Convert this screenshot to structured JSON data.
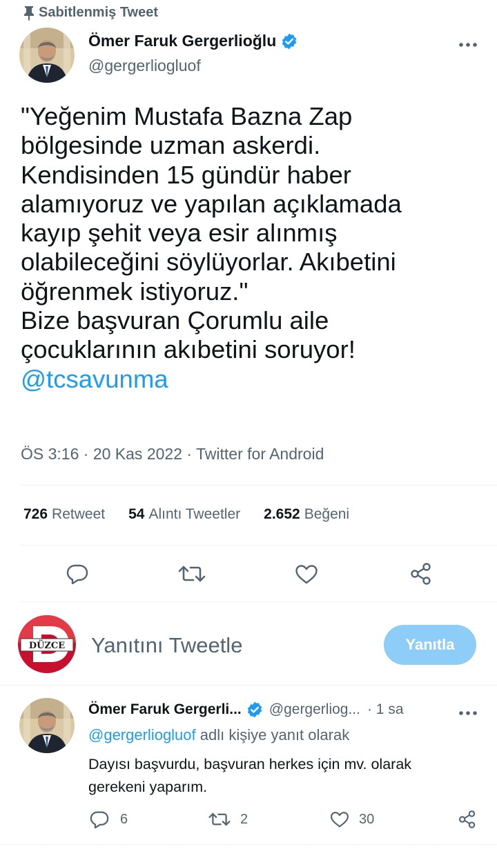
{
  "pinned": {
    "label": "Sabitlenmiş Tweet"
  },
  "tweet": {
    "author_name": "Ömer Faruk Gergerlioğlu",
    "author_handle": "@gergerliogluof",
    "text_main": "\"Yeğenim Mustafa Bazna Zap\nbölgesinde uzman askerdi.\nKendisinden 15 gündür haber\nalamıyoruz ve yapılan açıklamada\nkayıp şehit veya esir alınmış\nolabileceğini söylüyorlar. Akıbetini\nöğrenmek istiyoruz.\"\nBize başvuran Çorumlu aile\nçocuklarının akıbetini soruyor!",
    "mention": "@tcsavunma",
    "meta": "ÖS 3:16 · 20 Kas 2022 · Twitter for Android",
    "stats": {
      "retweets_count": "726",
      "retweets_label": "Retweet",
      "quotes_count": "54",
      "quotes_label": "Alıntı Tweetler",
      "likes_count": "2.652",
      "likes_label": "Beğeni"
    },
    "actions": [
      "reply-icon",
      "retweet-icon",
      "like-icon",
      "share-icon"
    ]
  },
  "compose": {
    "avatar_text": "DÜZCE",
    "placeholder": "Yanıtını Tweetle",
    "reply_button": "Yanıtla"
  },
  "reply": {
    "author_name": "Ömer Faruk Gergerli...",
    "author_handle": "@gergerliog...",
    "time": "· 1 sa",
    "replying_to_handle": "@gergerliogluof",
    "replying_to_suffix": " adlı kişiye yanıt olarak",
    "text": "Dayısı başvurdu, başvuran herkes için mv. olarak\ngerekeni yaparım.",
    "reply_count": "6",
    "retweet_count": "2",
    "like_count": "30"
  },
  "colors": {
    "accent": "#1d9bf0",
    "verified": "#1d9bf0",
    "muted": "#536471",
    "reply_button_bg": "#8ecdf8"
  }
}
